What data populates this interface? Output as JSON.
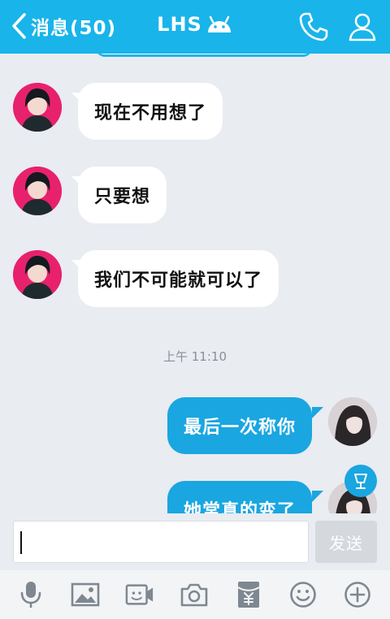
{
  "header": {
    "back_label": "消息(50)",
    "title": "LHS"
  },
  "messages": [
    {
      "direction": "incoming",
      "text": "现在不用想了"
    },
    {
      "direction": "incoming",
      "text": "只要想"
    },
    {
      "direction": "incoming",
      "text": "我们不可能就可以了"
    },
    {
      "direction": "outgoing",
      "text": "最后一次称你"
    },
    {
      "direction": "outgoing",
      "text": "她常真的变了"
    }
  ],
  "timestamp": "上午 11:10",
  "composer": {
    "input_value": "",
    "send_label": "发送"
  },
  "toolbar": {
    "icons": [
      "microphone-icon",
      "image-icon",
      "video-call-icon",
      "camera-icon",
      "red-packet-icon",
      "emoji-icon",
      "plus-icon"
    ]
  },
  "colors": {
    "header": "#19b4ea",
    "outgoing_bubble": "#1aa6e0",
    "incoming_bubble": "#ffffff",
    "background": "#e9ecf1",
    "avatar_incoming": "#e8216c",
    "send_disabled": "#d5d8dc"
  }
}
